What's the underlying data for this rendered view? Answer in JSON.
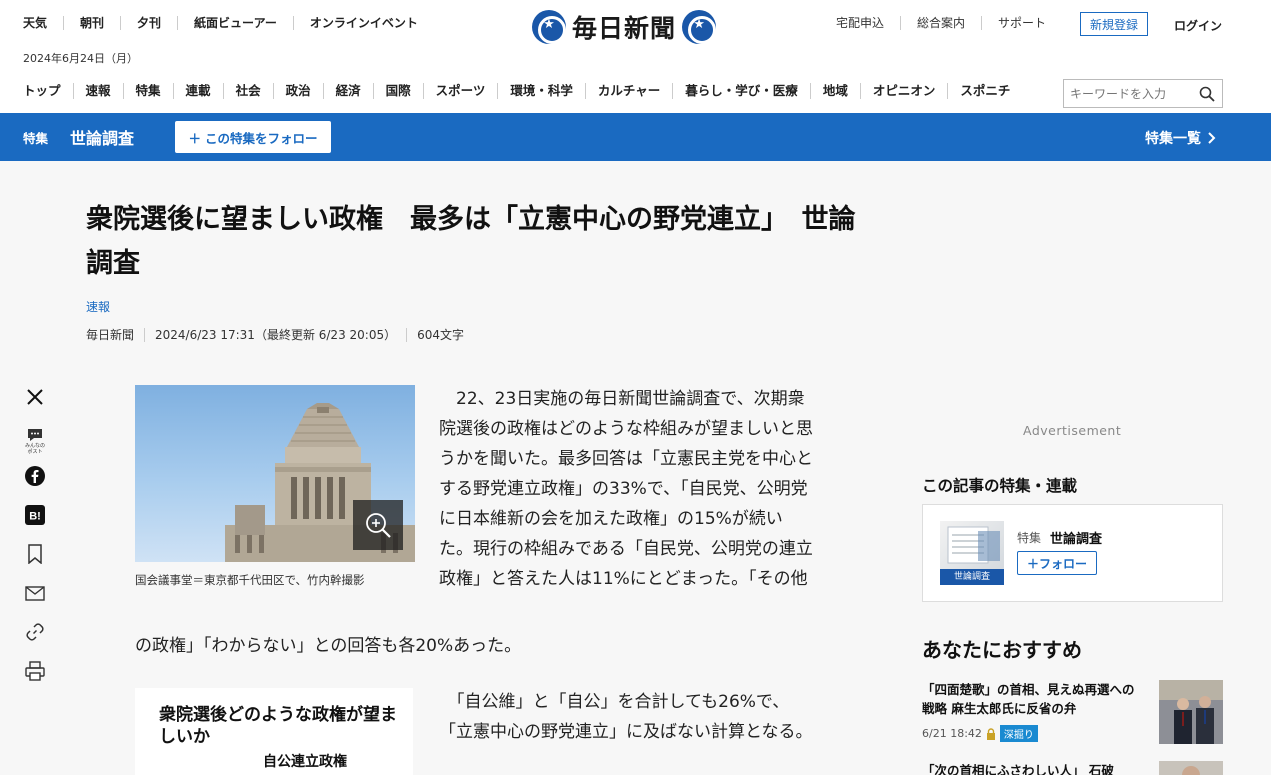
{
  "header": {
    "top_links": [
      "天気",
      "朝刊",
      "夕刊",
      "紙面ビューアー",
      "オンラインイベント"
    ],
    "date": "2024年6月24日（月）",
    "logo_text": "毎日新聞",
    "right_links": [
      "宅配申込",
      "総合案内",
      "サポート"
    ],
    "register_label": "新規登録",
    "login_label": "ログイン"
  },
  "nav": {
    "items": [
      "トップ",
      "速報",
      "特集",
      "連載",
      "社会",
      "政治",
      "経済",
      "国際",
      "スポーツ",
      "環境・科学",
      "カルチャー",
      "暮らし・学び・医療",
      "地域",
      "オピニオン",
      "スポニチ"
    ],
    "search_placeholder": "キーワードを入力"
  },
  "feature_band": {
    "tag": "特集",
    "title": "世論調査",
    "follow_label": "この特集をフォロー",
    "list_label": "特集一覧"
  },
  "article": {
    "headline": "衆院選後に望ましい政権　最多は「立憲中心の野党連立」　世論調査",
    "category": "速報",
    "meta": [
      "毎日新聞",
      "2024/6/23 17:31（最終更新 6/23 20:05）",
      "604文字"
    ],
    "photo_caption": "国会議事堂＝東京都千代田区で、竹内幹撮影",
    "paragraph1_main": "　22、23日実施の毎日新聞世論調査で、次期衆院選後の政権はどのような枠組みが望ましいと思うかを聞いた。最多回答は「立憲民主党を中心とする野党連立政権」の33%で、「自民党、公明党に日本維新の会を加えた政権」の15%が続いた。現行の枠組みである「自民党、公明党の連立政権」と答えた人は11%にとどまった。「その他",
    "paragraph1_tail": "の政権」「わからない」との回答も各20%あった。",
    "paragraph2": "　「自公維」と「自公」を合計しても26%で、「立憲中心の野党連立」に及ばない計算となる。",
    "infographic_title": "衆院選後どのような政権が望ましいか",
    "infographic_label": "自公連立政権"
  },
  "share": {
    "icons": [
      "x-icon",
      "minna-no-post-icon",
      "facebook-icon",
      "hatena-bookmark-icon",
      "bookmark-icon",
      "mail-icon",
      "link-icon",
      "print-icon"
    ],
    "minna_label": "みんなのポスト"
  },
  "sidebar": {
    "ad_label": "Advertisement",
    "series_title": "この記事の特集・連載",
    "series_card": {
      "tag": "特集",
      "name": "世論調査",
      "thumb_label": "世論調査",
      "follow_label": "フォロー"
    },
    "recommend_title": "あなたにおすすめ",
    "recommend": [
      {
        "text": "「四面楚歌」の首相、見えぬ再選への戦略 麻生太郎氏に反省の弁",
        "date": "6/21 18:42",
        "badge": "深掘り"
      },
      {
        "text": "「次の首相にふさわしい人」 石破",
        "date": "",
        "badge": ""
      }
    ]
  },
  "colors": {
    "accent": "#1a6ac1",
    "logo_blue": "#1a57a8",
    "page_bg": "#f7f7f7"
  }
}
